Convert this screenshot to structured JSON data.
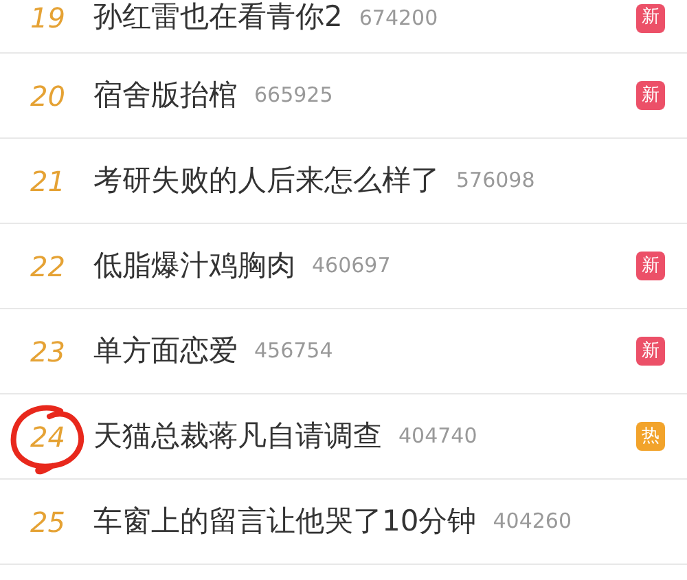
{
  "hot_list": [
    {
      "rank": "19",
      "title": "孙红雷也在看青你2",
      "count": "674200",
      "badge": {
        "text": "新",
        "kind": "new"
      },
      "circled": false
    },
    {
      "rank": "20",
      "title": "宿舍版抬棺",
      "count": "665925",
      "badge": {
        "text": "新",
        "kind": "new"
      },
      "circled": false
    },
    {
      "rank": "21",
      "title": "考研失败的人后来怎么样了",
      "count": "576098",
      "circled": false
    },
    {
      "rank": "22",
      "title": "低脂爆汁鸡胸肉",
      "count": "460697",
      "badge": {
        "text": "新",
        "kind": "new"
      },
      "circled": false
    },
    {
      "rank": "23",
      "title": "单方面恋爱",
      "count": "456754",
      "badge": {
        "text": "新",
        "kind": "new"
      },
      "circled": false
    },
    {
      "rank": "24",
      "title": "天猫总裁蒋凡自请调查",
      "count": "404740",
      "badge": {
        "text": "热",
        "kind": "hot"
      },
      "circled": true
    },
    {
      "rank": "25",
      "title": "车窗上的留言让他哭了10分钟",
      "count": "404260",
      "circled": false
    }
  ]
}
